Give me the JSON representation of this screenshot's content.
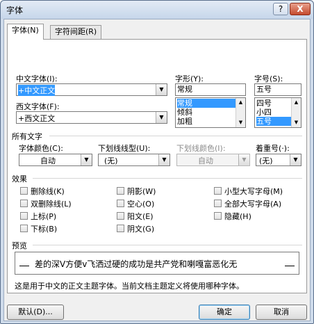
{
  "window": {
    "title": "字体",
    "help_glyph": "?",
    "close_glyph": "X"
  },
  "tabs": [
    {
      "label": "字体(N)",
      "active": true
    },
    {
      "label": "字符间距(R)",
      "active": false
    }
  ],
  "font": {
    "chinese_label": "中文字体(I):",
    "chinese_value": "+中文正文",
    "western_label": "西文字体(F):",
    "western_value": "+西文正文",
    "style_label": "字形(Y):",
    "style_value": "常规",
    "style_options": [
      "常规",
      "倾斜",
      "加粗"
    ],
    "size_label": "字号(S):",
    "size_value": "五号",
    "size_options": [
      "四号",
      "小四",
      "五号"
    ]
  },
  "all_text": {
    "section_label": "所有文字",
    "font_color_label": "字体颜色(C):",
    "font_color_value": "自动",
    "underline_label": "下划线线型(U):",
    "underline_value": "(无)",
    "underline_color_label": "下划线颜色(I):",
    "underline_color_value": "自动",
    "emphasis_label": "着重号(·):",
    "emphasis_value": "(无)"
  },
  "effects": {
    "section_label": "效果",
    "col1": [
      "删除线(K)",
      "双删除线(L)",
      "上标(P)",
      "下标(B)"
    ],
    "col2": [
      "阴影(W)",
      "空心(O)",
      "阳文(E)",
      "阴文(G)"
    ],
    "col3": [
      "小型大写字母(M)",
      "全部大写字母(A)",
      "隐藏(H)"
    ]
  },
  "preview": {
    "section_label": "预览",
    "sample_text": "差的深V方便v飞洒过硬的成功是共产党和喇嘎富恶化无",
    "description": "这是用于中文的正文主题字体。当前文档主题定义将使用哪种字体。"
  },
  "buttons": {
    "default_label": "默认(D)...",
    "ok_label": "确定",
    "cancel_label": "取消"
  }
}
